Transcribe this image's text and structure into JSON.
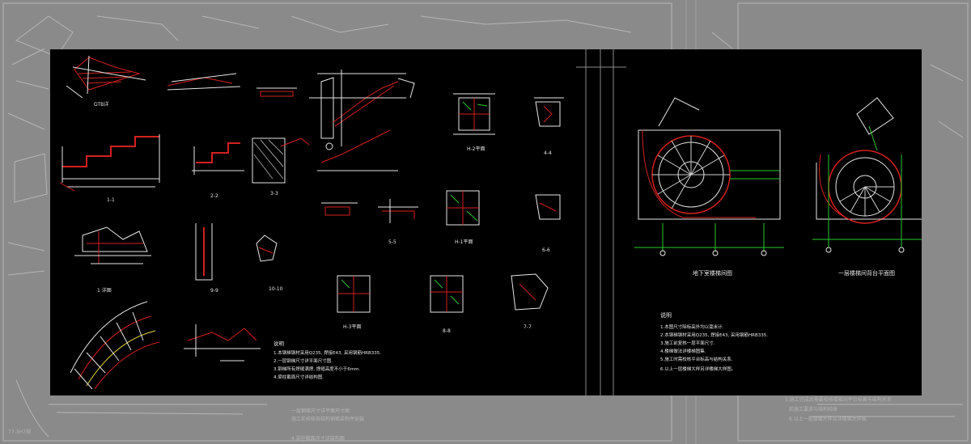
{
  "left_sheet": {
    "section_labels": [
      "GTB详",
      "1-1",
      "2-2",
      "3-3",
      "1 详图",
      "9-9",
      "10-10",
      "5-5",
      "6-6",
      "4-4",
      "7-7",
      "8-8",
      "H-1平面",
      "H-2平面",
      "H-3平面"
    ],
    "notes_title": "说明",
    "notes": [
      "1.本钢梯钢材采用Q235, 焊接E43, 采用钢筋HRB335.",
      "2.一层钢梯尺寸详平面尺寸图.",
      "3.钢梯所有焊缝满焊, 焊缝高度不小于6mm.",
      "4.梁柱截面尺寸详结构图."
    ]
  },
  "right_sheet": {
    "plan_left_title": "地下室楼梯间图",
    "plan_right_title": "一层楼梯间背台平面图",
    "notes_title": "说明",
    "notes": [
      "1.本图尺寸除标高外均以毫米计.",
      "2.本钢梯钢材采用Q235, 焊接E43, 采用钢筋HRB335.",
      "3.施工前复核一层平面尺寸.",
      "4.楼梯做法详楼梯图集.",
      "5.施工时需校核平台标高与结构关系.",
      "6.以上一层楼梯大样另详楼梯大样图。"
    ]
  },
  "colors": {
    "line_red": "#d42020",
    "line_white": "#e6e6e6",
    "line_green": "#2ec72e",
    "line_yellow": "#e0d23a",
    "background": "#000000",
    "frame": "#8c8c8c"
  }
}
